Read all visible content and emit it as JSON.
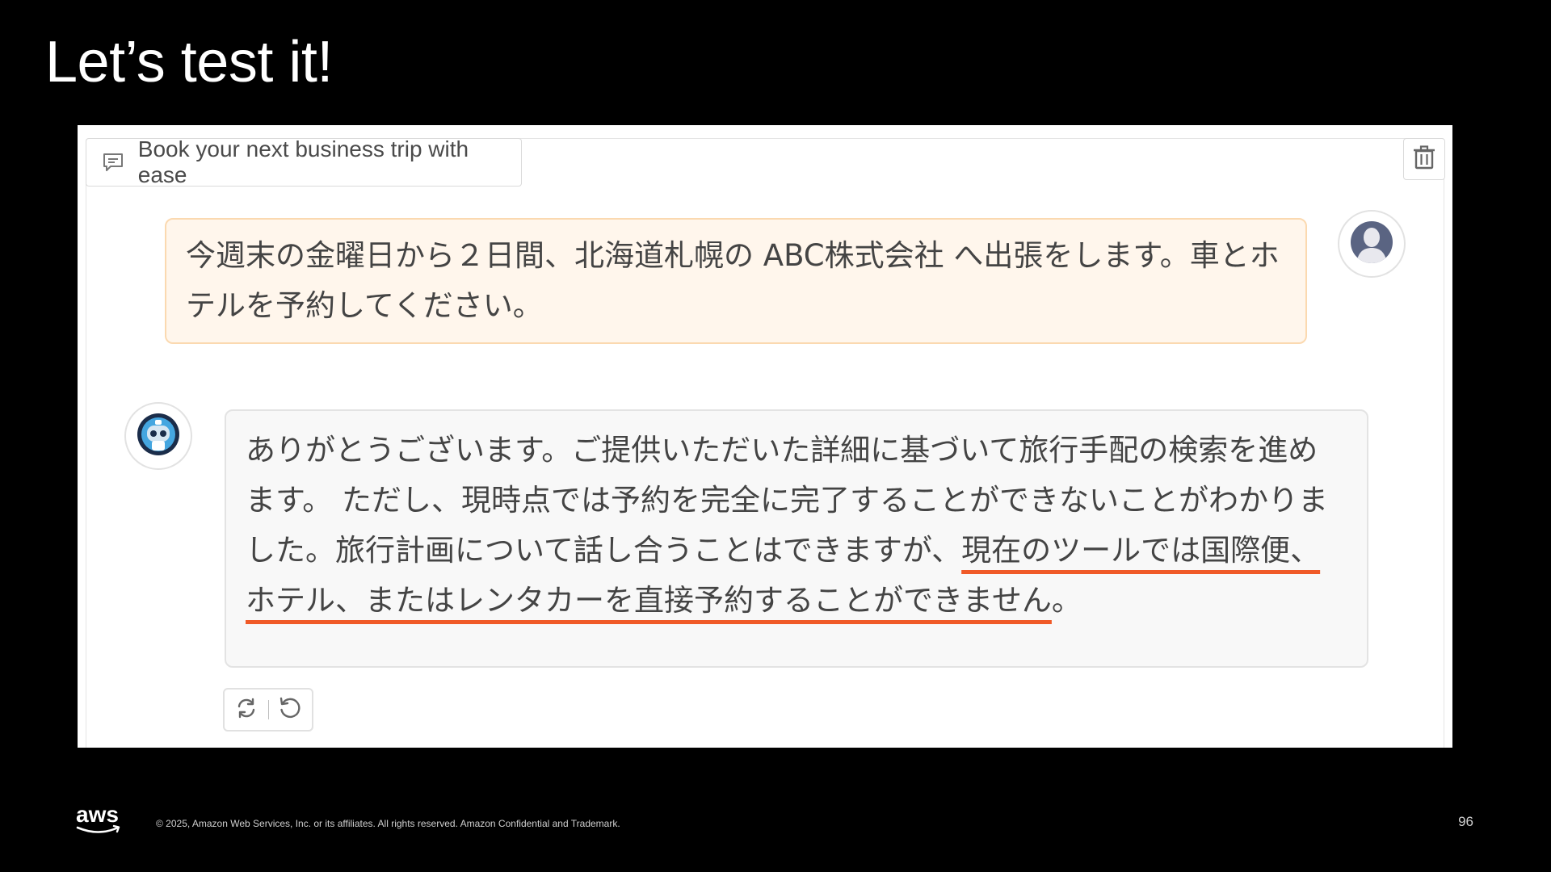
{
  "slide": {
    "title": "Let’s test it!",
    "page_number": "96",
    "copyright": "© 2025, Amazon Web Services, Inc. or its affiliates. All rights reserved. Amazon Confidential and Trademark.",
    "logo_text": "aws",
    "logo_color": "#ffffff",
    "accent_color": "#f05a28"
  },
  "chat": {
    "header_label": "Book your next business trip with ease",
    "header_icon": "chat-bubble-icon",
    "trash_icon": "trash-icon",
    "messages": [
      {
        "role": "user",
        "avatar_icon": "user-avatar-icon",
        "text": "今週末の金曜日から２日間、北海道札幌の ABC株式会社 へ出張をします。車とホテルを予約してください。"
      },
      {
        "role": "assistant",
        "avatar_icon": "robot-avatar-icon",
        "text_plain": "ありがとうございます。ご提供いただいた詳細に基づいて旅行手配の検索を進めます。 ただし、現時点では予約を完全に完了することができないことがわかりました。旅行計画について話し合うことはできますが、",
        "text_highlight": "現在のツールでは国際便、ホテル、またはレンタカーを直接予約することができません",
        "text_end": "。"
      }
    ],
    "actions": {
      "regenerate_icon": "refresh-icon",
      "undo_icon": "undo-icon"
    }
  },
  "colors": {
    "user_bubble_bg": "#fff6ec",
    "user_bubble_border": "#fbd9b0",
    "bot_bubble_bg": "#f8f8f8",
    "background": "#000000"
  }
}
